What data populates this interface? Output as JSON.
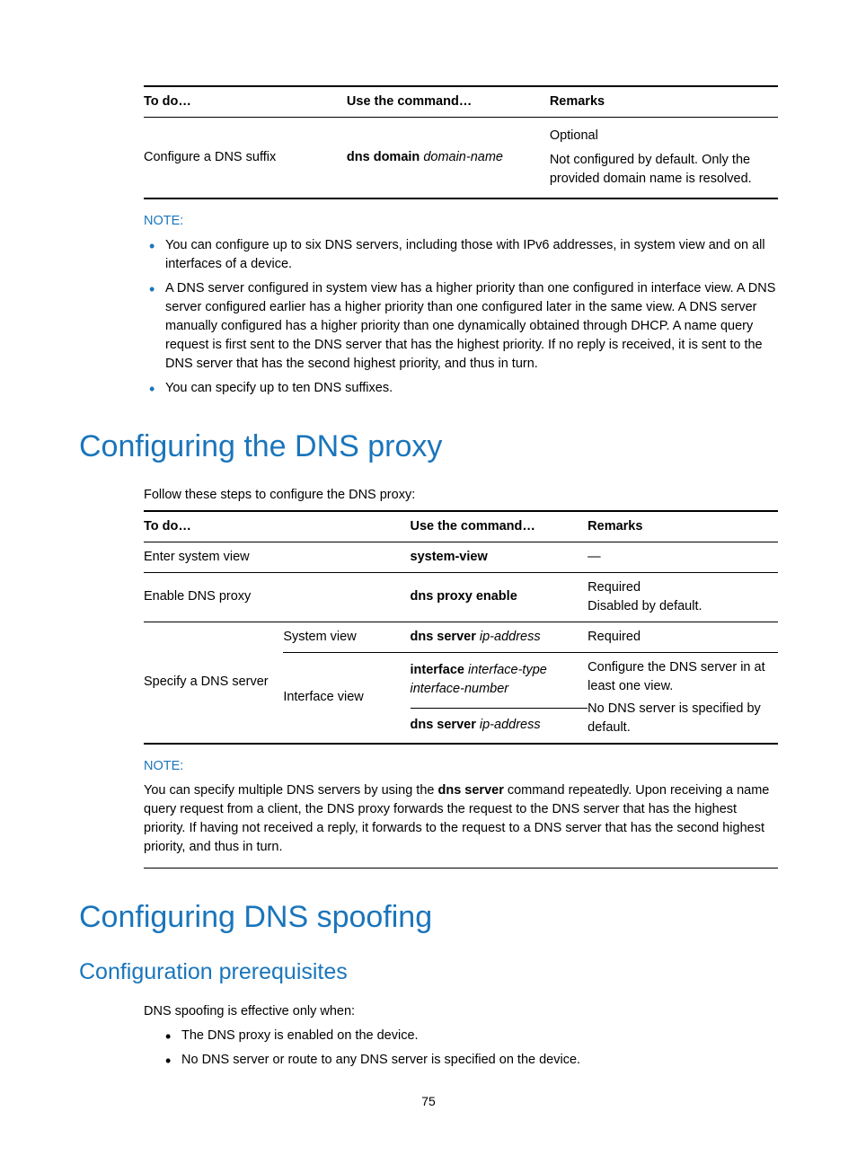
{
  "table1": {
    "headers": [
      "To do…",
      "Use the command…",
      "Remarks"
    ],
    "row": {
      "todo": "Configure a DNS suffix",
      "cmd_bold": "dns domain",
      "cmd_italic": "domain-name",
      "remarks_line1": "Optional",
      "remarks_line2": "Not configured by default. Only the provided domain name is resolved."
    }
  },
  "note1": {
    "label": "NOTE:",
    "items": [
      "You can configure up to six DNS servers, including those with IPv6 addresses, in system view and on all interfaces of a device.",
      "A DNS server configured in system view has a higher priority than one configured in interface view. A DNS server configured earlier has a higher priority than one configured later in the same view. A DNS server manually configured has a higher priority than one dynamically obtained through DHCP. A name query request is first sent to the DNS server that has the highest priority. If no reply is received, it is sent to the DNS server that has the second highest priority, and thus in turn.",
      "You can specify up to ten DNS suffixes."
    ]
  },
  "heading1": "Configuring the DNS proxy",
  "intro1": "Follow these steps to configure the DNS proxy:",
  "table2": {
    "headers": [
      "To do…",
      "Use the command…",
      "Remarks"
    ],
    "r1": {
      "todo": "Enter system view",
      "cmd": "system-view",
      "remarks": "—"
    },
    "r2": {
      "todo": "Enable DNS proxy",
      "cmd": "dns proxy enable",
      "remarks_l1": "Required",
      "remarks_l2": "Disabled by default."
    },
    "r3": {
      "todo": "Specify a DNS server",
      "view1": "System view",
      "view2": "Interface view",
      "cmd1_bold": "dns server",
      "cmd1_italic": "ip-address",
      "cmd2_bold": "interface",
      "cmd2_italic": "interface-type interface-number",
      "cmd3_bold": "dns server",
      "cmd3_italic": "ip-address",
      "remarks_l1": "Required",
      "remarks_l2": "Configure the DNS server in at least one view.",
      "remarks_l3": "No DNS server is specified by default."
    }
  },
  "note2": {
    "label": "NOTE:",
    "body_pre": "You can specify multiple DNS servers by using the ",
    "body_bold": "dns server",
    "body_post": " command repeatedly. Upon receiving a name query request from a client, the DNS proxy forwards the request to the DNS server that has the highest priority. If having not received a reply, it forwards to the request to a DNS server that has the second highest priority, and thus in turn."
  },
  "heading2": "Configuring DNS spoofing",
  "subheading2": "Configuration prerequisites",
  "prereq_intro": "DNS spoofing is effective only when:",
  "prereq_items": [
    "The DNS proxy is enabled on the device.",
    "No DNS server or route to any DNS server is specified on the device."
  ],
  "page_number": "75"
}
